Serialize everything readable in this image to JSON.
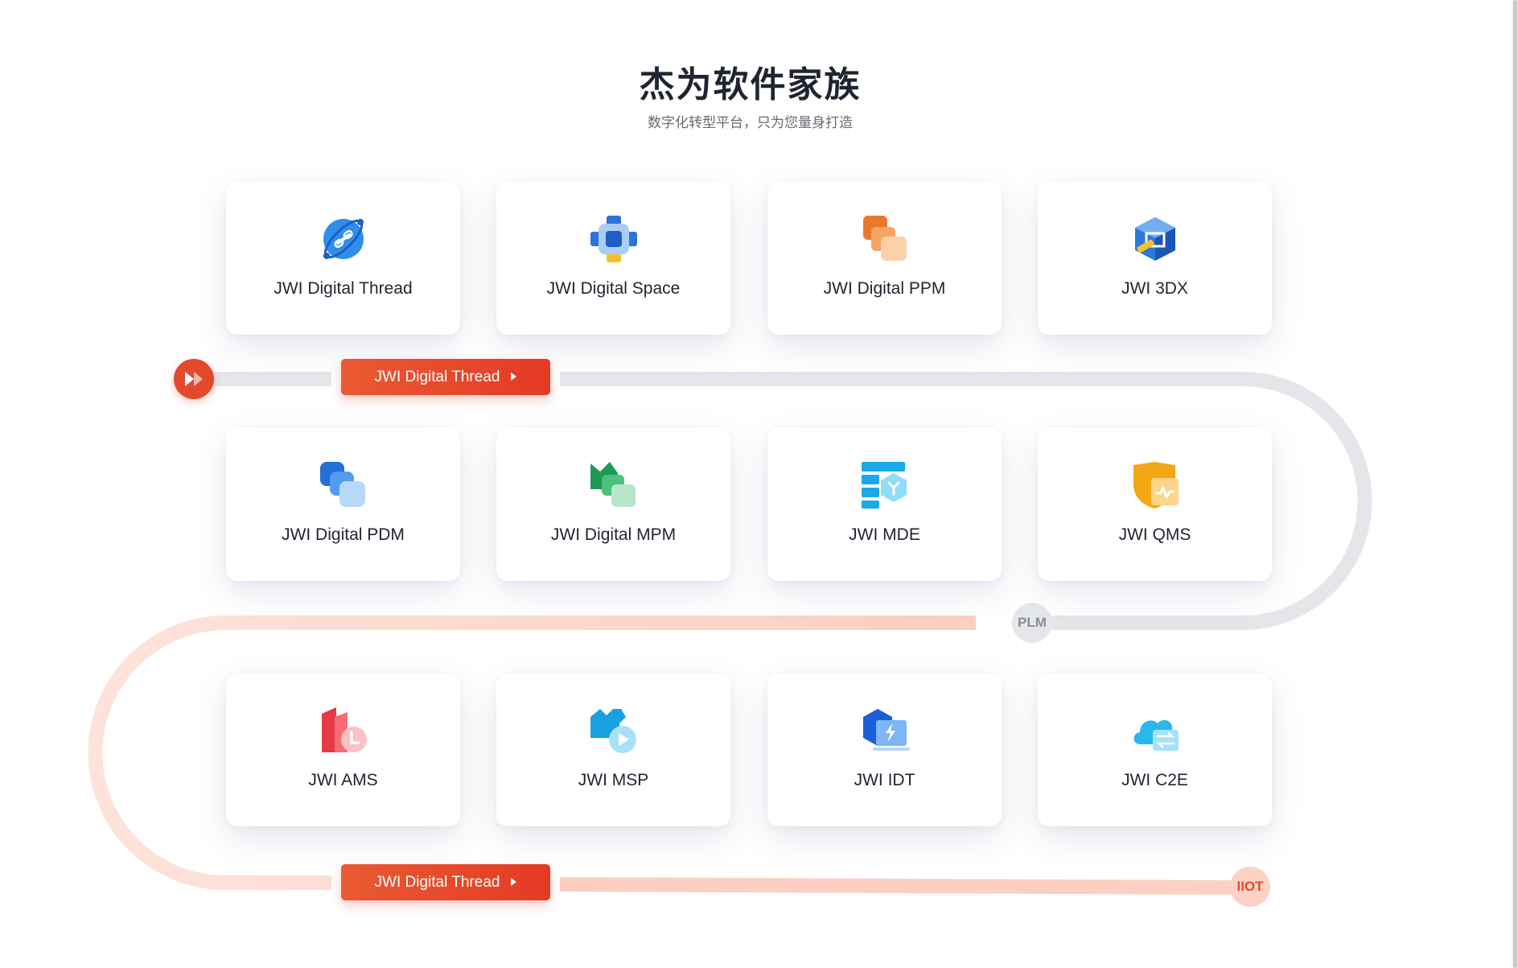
{
  "header": {
    "title": "杰为软件家族",
    "subtitle": "数字化转型平台，只为您量身打造"
  },
  "rows": [
    [
      {
        "name": "JWI Digital Thread",
        "icon": "digital-thread-icon"
      },
      {
        "name": "JWI Digital Space",
        "icon": "digital-space-icon"
      },
      {
        "name": "JWI Digital PPM",
        "icon": "digital-ppm-icon"
      },
      {
        "name": "JWI 3DX",
        "icon": "3dx-icon"
      }
    ],
    [
      {
        "name": "JWI Digital PDM",
        "icon": "digital-pdm-icon"
      },
      {
        "name": "JWI Digital MPM",
        "icon": "digital-mpm-icon"
      },
      {
        "name": "JWI MDE",
        "icon": "mde-icon"
      },
      {
        "name": "JWI QMS",
        "icon": "qms-icon"
      }
    ],
    [
      {
        "name": "JWI AMS",
        "icon": "ams-icon"
      },
      {
        "name": "JWI MSP",
        "icon": "msp-icon"
      },
      {
        "name": "JWI IDT",
        "icon": "idt-icon"
      },
      {
        "name": "JWI C2E",
        "icon": "c2e-icon"
      }
    ]
  ],
  "thread_buttons": [
    {
      "label": "JWI Digital Thread"
    },
    {
      "label": "JWI Digital Thread"
    }
  ],
  "nodes": {
    "plm": "PLM",
    "iiot": "IIOT"
  },
  "colors": {
    "accent": "#e5452a",
    "rail_gray": "#e4e6ea",
    "rail_pink": "#fcd9ce"
  }
}
